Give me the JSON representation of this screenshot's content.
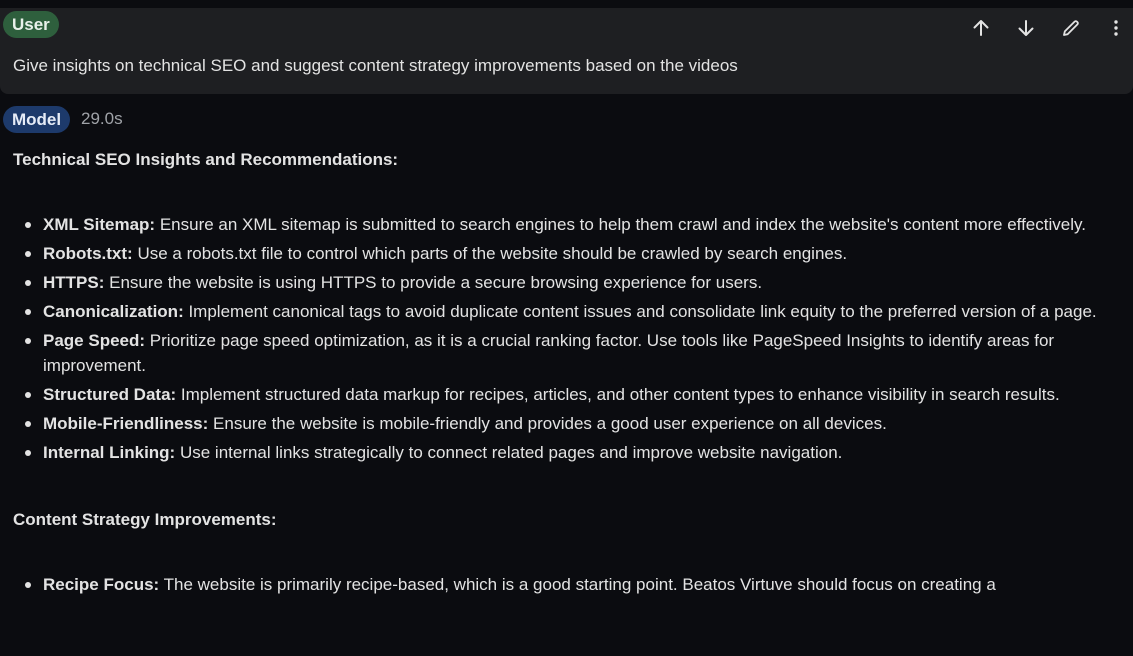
{
  "user": {
    "role_label": "User",
    "prompt": "Give insights on technical SEO and suggest content strategy improvements based on the videos",
    "actions": [
      {
        "icon": "arrow-up-icon"
      },
      {
        "icon": "arrow-down-icon"
      },
      {
        "icon": "edit-pencil-icon"
      },
      {
        "icon": "more-vertical-icon"
      }
    ]
  },
  "model": {
    "role_label": "Model",
    "elapsed": "29.0s",
    "sections": [
      {
        "heading": "Technical SEO Insights and Recommendations:",
        "items": [
          {
            "term": "XML Sitemap:",
            "text": " Ensure an XML sitemap is submitted to search engines to help them crawl and index the website's content more effectively."
          },
          {
            "term": "Robots.txt:",
            "text": " Use a robots.txt file to control which parts of the website should be crawled by search engines."
          },
          {
            "term": "HTTPS:",
            "text": " Ensure the website is using HTTPS to provide a secure browsing experience for users."
          },
          {
            "term": "Canonicalization:",
            "text": " Implement canonical tags to avoid duplicate content issues and consolidate link equity to the preferred version of a page."
          },
          {
            "term": "Page Speed:",
            "text": " Prioritize page speed optimization, as it is a crucial ranking factor. Use tools like PageSpeed Insights to identify areas for improvement."
          },
          {
            "term": "Structured Data:",
            "text": " Implement structured data markup for recipes, articles, and other content types to enhance visibility in search results."
          },
          {
            "term": "Mobile-Friendliness:",
            "text": " Ensure the website is mobile-friendly and provides a good user experience on all devices."
          },
          {
            "term": "Internal Linking:",
            "text": " Use internal links strategically to connect related pages and improve website navigation."
          }
        ]
      },
      {
        "heading": "Content Strategy Improvements:",
        "items": [
          {
            "term": "Recipe Focus:",
            "text": " The website is primarily recipe-based, which is a good starting point. Beatos Virtuve should focus on creating a"
          }
        ]
      }
    ]
  }
}
